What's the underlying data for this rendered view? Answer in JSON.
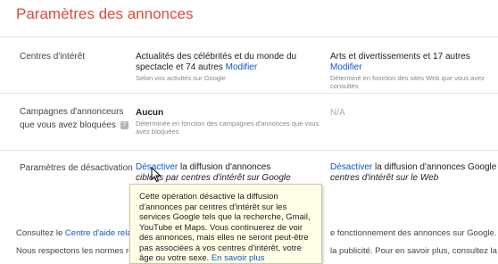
{
  "page": {
    "title": "Paramètres des annonces"
  },
  "rows": {
    "interests": {
      "label": "Centres d'intérêt",
      "search": {
        "text": "Actualités des célébrités et du monde du spectacle et 74 autres",
        "link": "Modifier",
        "sub": "Selon vos activités sur Google"
      },
      "web": {
        "text": "Arts et divertissements et 17 autres",
        "link": "Modifier",
        "sub": "Déterminé en fonction des sites Web que vous avez consultés"
      }
    },
    "campaigns": {
      "label_line1": "Campagnes d'annonceurs",
      "label_line2": "que vous avez bloquées",
      "help_glyph": "?",
      "search": {
        "value": "Aucun",
        "sub": "Déterminée en fonction des campagnes d'annonces que vous avez bloquées"
      },
      "web": {
        "value": "N/A"
      }
    },
    "optout": {
      "label": "Paramètres de désactivation",
      "search": {
        "link": "Désactiver",
        "text1": "la diffusion d'annonces",
        "text2": "ciblées par centres d'intérêt sur Google"
      },
      "web": {
        "link": "Désactiver",
        "text1": "la diffusion d'annonces Google par",
        "text2": "centres d'intérêt sur le Web"
      }
    }
  },
  "footer": {
    "line1_a": "Consultez le",
    "line1_link": "Centre d'aide relat",
    "line1_b": "e fonctionnement des annonces sur Google.",
    "line2_a": "Nous respectons les normes re",
    "line2_b": "la publicité. Pour en savoir plus, consultez la p"
  },
  "tooltip": {
    "text": "Cette opération désactive la diffusion d'annonces par centres d'intérêt sur les services Google tels que la recherche, Gmail, YouTube et Maps. Vous continuerez de voir des annonces, mais elles ne seront peut-être pas associées à vos centres d'intérêt, votre âge ou votre sexe.",
    "link": "En savoir plus"
  },
  "icons": {
    "help": "help-icon",
    "cursor": "mouse-pointer-icon"
  },
  "colors": {
    "title": "#dd4b39",
    "link": "#1155cc",
    "tooltip_bg": "#ffffe8"
  }
}
